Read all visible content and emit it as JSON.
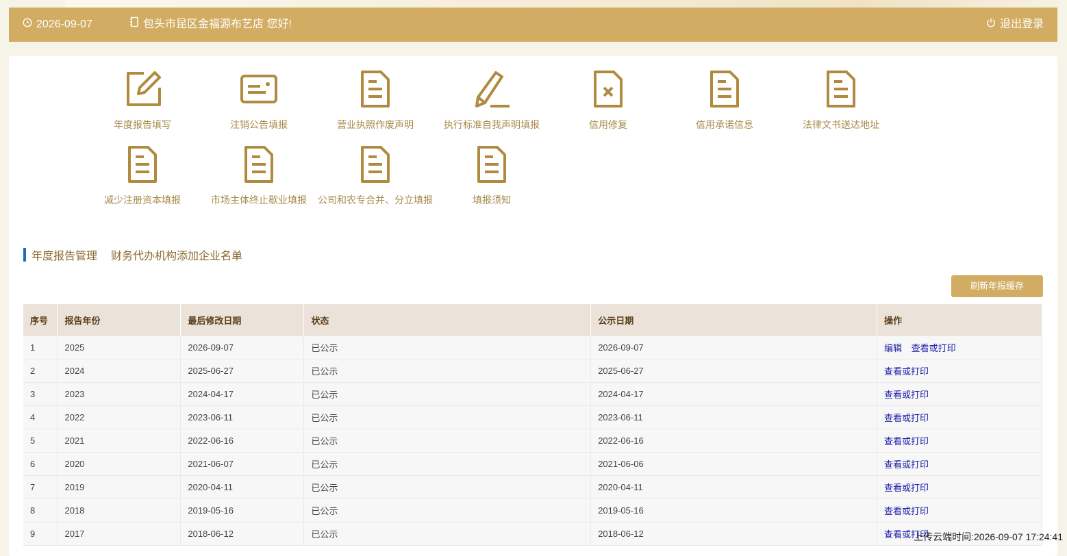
{
  "header": {
    "date": "2026-09-07",
    "greeting": "包头市昆区金福源布艺店 您好!",
    "logout_label": "退出登录"
  },
  "menu": [
    {
      "label": "年度报告填写",
      "icon": "edit-icon"
    },
    {
      "label": "注销公告填报",
      "icon": "card-icon"
    },
    {
      "label": "营业执照作废声明",
      "icon": "document-icon"
    },
    {
      "label": "执行标准自我声明填报",
      "icon": "pencil-icon"
    },
    {
      "label": "信用修复",
      "icon": "document-x-icon"
    },
    {
      "label": "信用承诺信息",
      "icon": "document-icon"
    },
    {
      "label": "法律文书送达地址",
      "icon": "document-icon"
    },
    {
      "label": "减少注册资本填报",
      "icon": "document-icon"
    },
    {
      "label": "市场主体终止歇业填报",
      "icon": "document-icon"
    },
    {
      "label": "公司和农专合并、分立填报",
      "icon": "document-icon"
    },
    {
      "label": "填报须知",
      "icon": "document-icon"
    }
  ],
  "tabs": {
    "active": "年度报告管理",
    "second": "财务代办机构添加企业名单"
  },
  "refresh_button": "刷新年报缓存",
  "table": {
    "headers": [
      "序号",
      "报告年份",
      "最后修改日期",
      "状态",
      "公示日期",
      "操作"
    ],
    "rows": [
      [
        "1",
        "2025",
        "2026-09-07",
        "已公示",
        "2026-09-07"
      ],
      [
        "2",
        "2024",
        "2025-06-27",
        "已公示",
        "2025-06-27"
      ],
      [
        "3",
        "2023",
        "2024-04-17",
        "已公示",
        "2024-04-17"
      ],
      [
        "4",
        "2022",
        "2023-06-11",
        "已公示",
        "2023-06-11"
      ],
      [
        "5",
        "2021",
        "2022-06-16",
        "已公示",
        "2022-06-16"
      ],
      [
        "6",
        "2020",
        "2021-06-07",
        "已公示",
        "2021-06-06"
      ],
      [
        "7",
        "2019",
        "2020-04-11",
        "已公示",
        "2020-04-11"
      ],
      [
        "8",
        "2018",
        "2019-05-16",
        "已公示",
        "2019-05-16"
      ],
      [
        "9",
        "2017",
        "2018-06-12",
        "已公示",
        "2018-06-12"
      ]
    ],
    "edit_label": "编辑",
    "view_label": "查看或打印"
  },
  "footer_time": "上传云端时间:2026-09-07 17:24:41",
  "colors": {
    "accent": "#d1ac62",
    "icon": "#b08a3e",
    "link": "#1a1aa8",
    "tab_marker": "#1b6fb8"
  }
}
